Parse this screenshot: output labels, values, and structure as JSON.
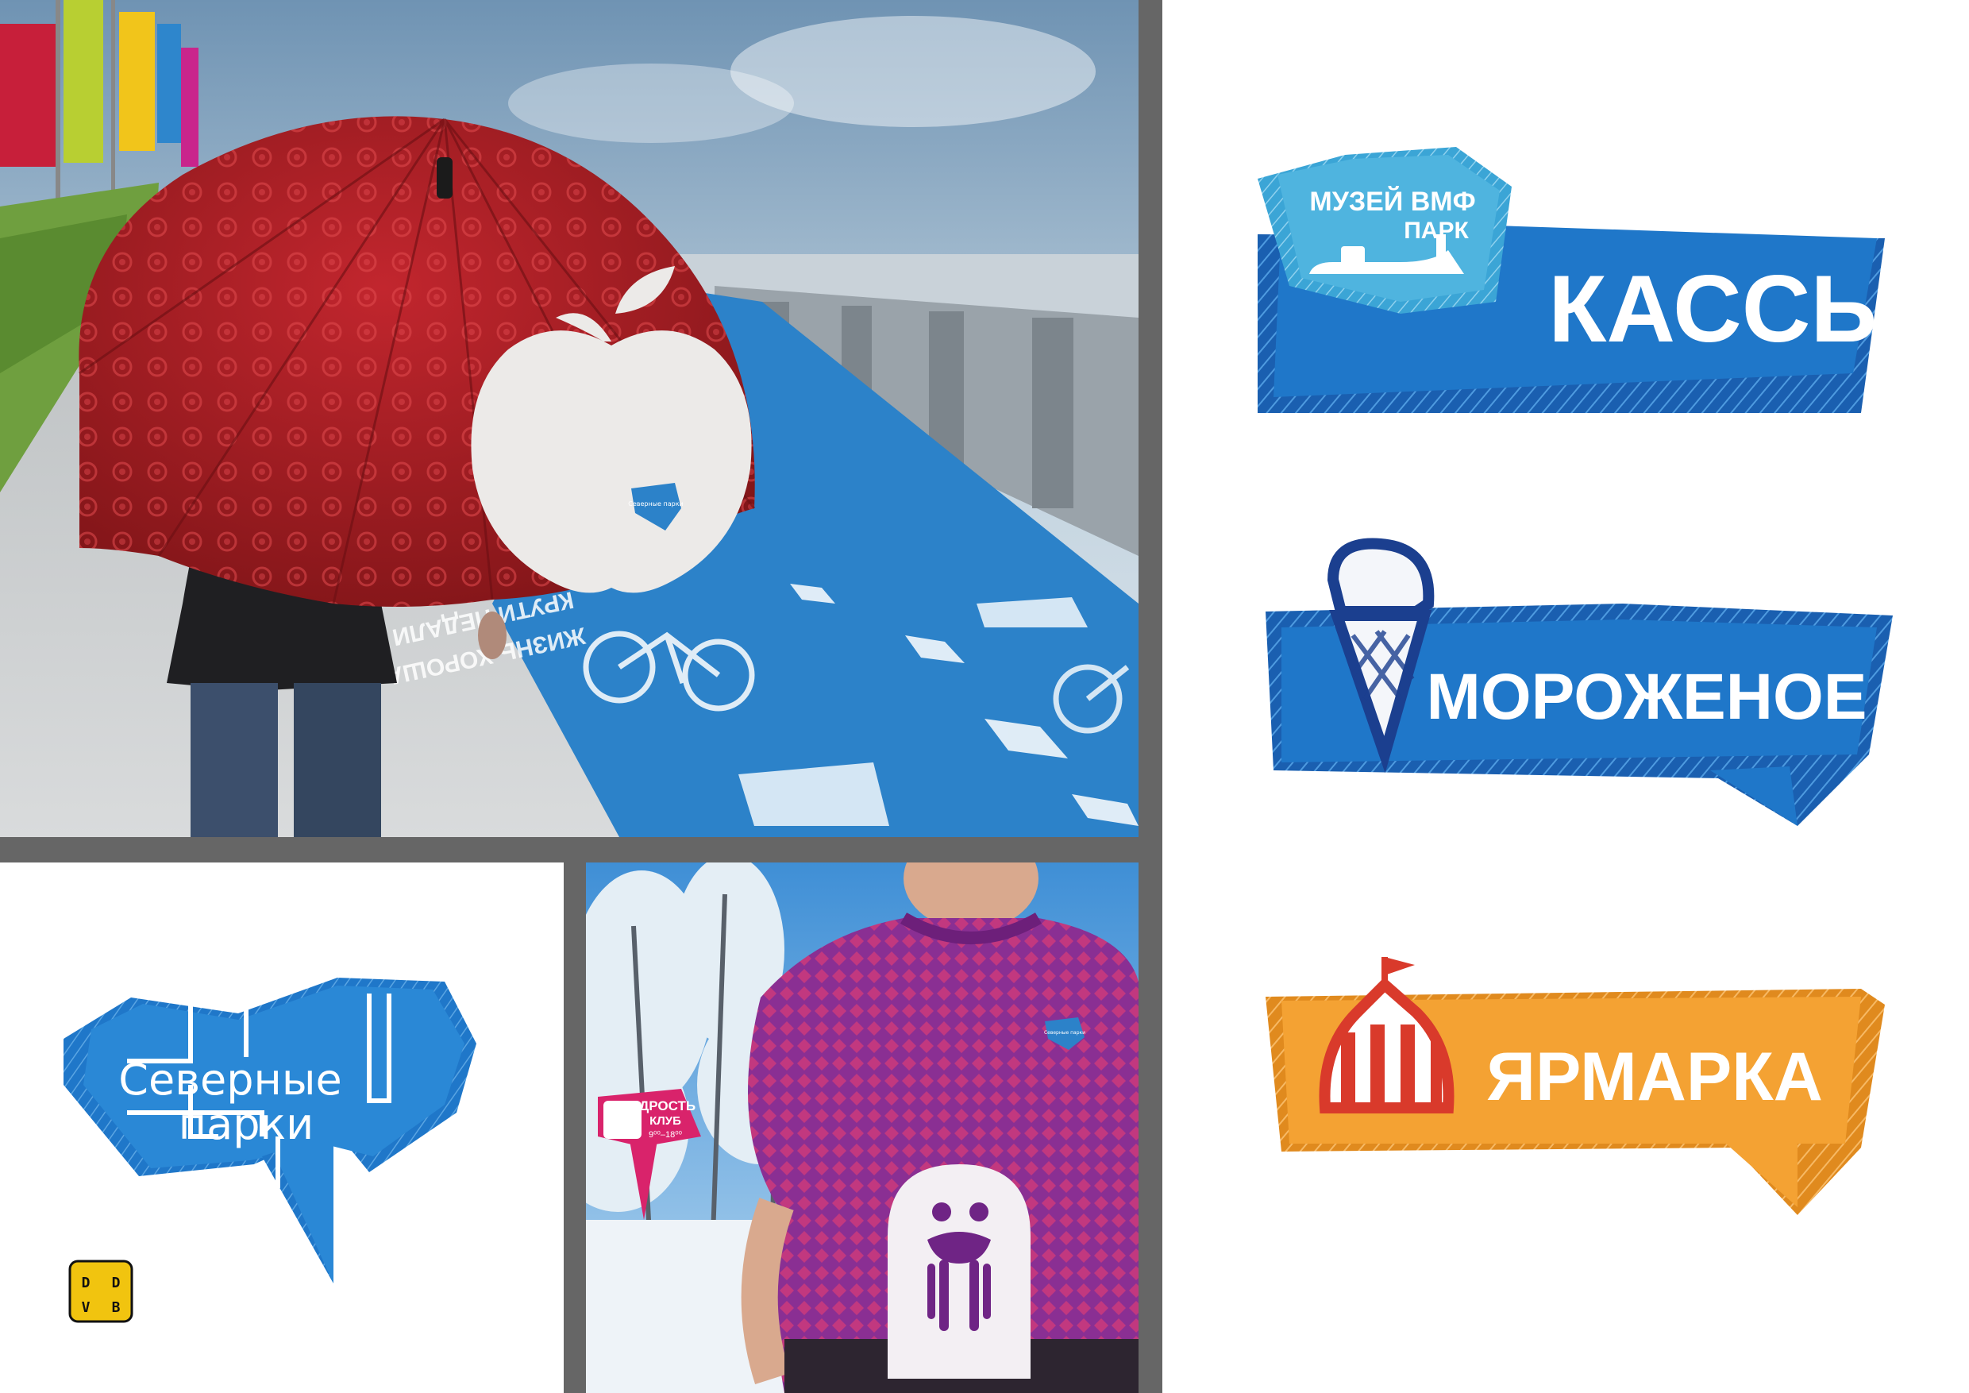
{
  "umbrella_photo": {
    "lane_text_1": "КРУТИ ПЕДАЛИ",
    "lane_text_2": "ЖИЗНЬ ХОРОША",
    "mini_logo": "Северные парки"
  },
  "logo_panel": {
    "logo_line1": "Северные",
    "logo_line2": "парки",
    "ddvb_letters": [
      "D",
      "D",
      "V",
      "B"
    ]
  },
  "tshirt_photo": {
    "sign_title": "БОДРОСТЬ",
    "sign_subtitle": "КЛУБ",
    "sign_hours": "9⁰⁰–18⁰⁰",
    "mini_logo": "Северные парки"
  },
  "signs": {
    "kassy": {
      "label": "КАССЫ",
      "badge_line1": "МУЗЕЙ ВМФ",
      "badge_line2": "ПАРК",
      "color": "#1f77c9",
      "badge_color": "#4fb4df"
    },
    "morozhenoe": {
      "label": "МОРОЖЕНОЕ",
      "color": "#1f77c9"
    },
    "yarmarka": {
      "label": "ЯРМАРКА",
      "color": "#f4a233",
      "accent": "#d93a2b"
    }
  },
  "colors": {
    "blue": "#1f77c9",
    "red": "#b8252d",
    "purple": "#7b2a8c",
    "magenta": "#c2387f",
    "divider": "#666666"
  }
}
